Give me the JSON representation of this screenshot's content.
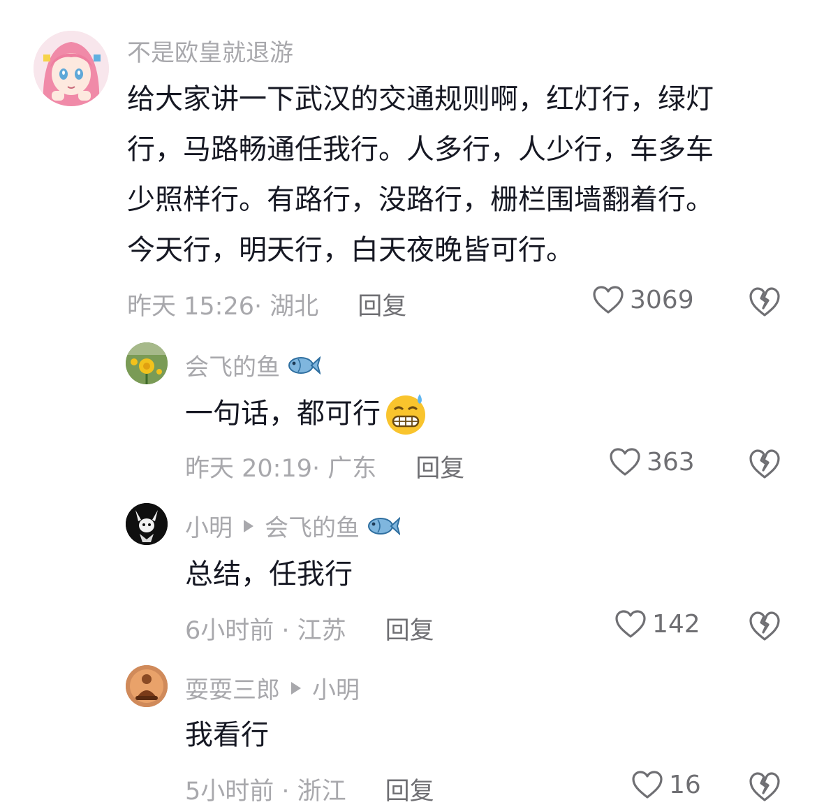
{
  "comments": [
    {
      "username": "不是欧皇就退游",
      "lines": [
        "给大家讲一下武汉的交通规则啊，红灯行，绿灯",
        "行，马路畅通任我行。人多行，人少行，车多车",
        "少照样行。有路行，没路行，栅栏围墙翻着行。",
        "今天行，明天行，白天夜晚皆可行。"
      ],
      "time_location": "昨天 15:26· 湖北",
      "reply_label": "回复",
      "likes": "3069",
      "avatar_icon": "anime-girl-pink-hair-avatar"
    },
    {
      "username": "会飞的鱼",
      "username_emoji": "fish-emoji",
      "text": "一句话，都可行",
      "text_emoji": "grinning-sweat-emoji",
      "time_location": "昨天 20:19· 广东",
      "reply_label": "回复",
      "likes": "363",
      "avatar_icon": "dandelion-flower-avatar"
    },
    {
      "username": "小明",
      "reply_to": "会飞的鱼",
      "reply_to_emoji": "fish-emoji",
      "text": "总结，任我行",
      "time_location": "6小时前 · 江苏",
      "reply_label": "回复",
      "likes": "142",
      "avatar_icon": "black-cartoon-character-avatar"
    },
    {
      "username": "耍耍三郎",
      "reply_to": "小明",
      "text": "我看行",
      "time_location": "5小时前 · 浙江",
      "reply_label": "回复",
      "likes": "16",
      "avatar_icon": "seated-monk-avatar"
    }
  ],
  "colors": {
    "text_primary": "#161823",
    "text_secondary": "#a8a8ac",
    "reply": "#6f6f73"
  }
}
